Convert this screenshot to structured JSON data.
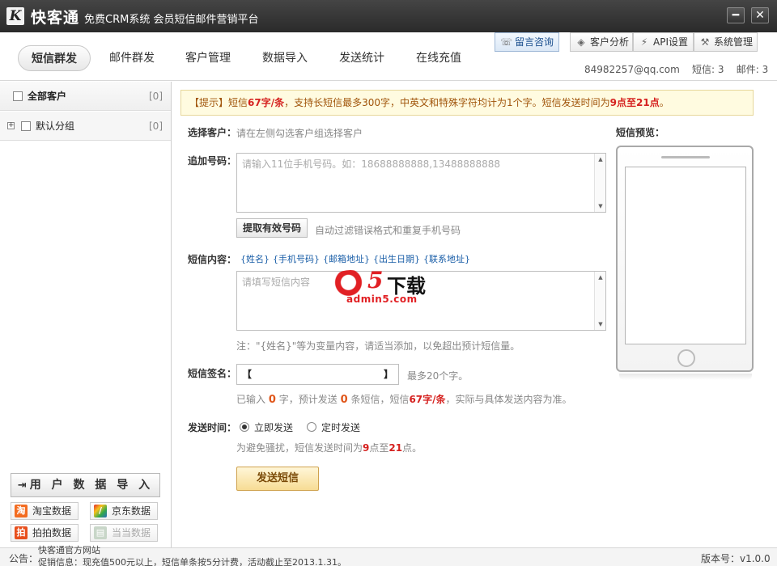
{
  "window": {
    "logo_letter": "K",
    "app_name": "快客通",
    "subtitle": "免费CRM系统 会员短信邮件营销平台",
    "minimize": "━",
    "close": "✕"
  },
  "nav": {
    "tabs": [
      {
        "label": "短信群发",
        "active": true
      },
      {
        "label": "邮件群发"
      },
      {
        "label": "客户管理"
      },
      {
        "label": "数据导入"
      },
      {
        "label": "发送统计"
      },
      {
        "label": "在线充值"
      }
    ],
    "top_buttons": {
      "message": "留言咨询",
      "analysis": "客户分析",
      "api": "API设置",
      "system": "系统管理"
    },
    "user": {
      "email": "84982257@qq.com",
      "sms_label": "短信: 3",
      "mail_label": "邮件: 3"
    }
  },
  "sidebar": {
    "all_customers": {
      "label": "全部客户",
      "count": "[0]"
    },
    "default_group": {
      "label": "默认分组",
      "count": "[0]"
    },
    "import_button": "用 户 数 据 导 入",
    "sources": [
      {
        "label": "淘宝数据",
        "icon": "淘"
      },
      {
        "label": "京东数据",
        "icon": "/"
      },
      {
        "label": "拍拍数据",
        "icon": "拍"
      },
      {
        "label": "当当数据",
        "icon": "▤",
        "disabled": true
      }
    ]
  },
  "tip": {
    "prefix": "【提示】短信",
    "rate": "67字/条",
    "middle": "，支持长短信最多300字，中英文和特殊字符均计为1个字。短信发送时间为",
    "hours": "9点至21点",
    "end": "。"
  },
  "form": {
    "select_customer_label": "选择客户：",
    "select_customer_hint": "请在左侧勾选客户组选择客户",
    "add_number_label": "追加号码：",
    "add_number_placeholder": "请输入11位手机号码。如：18688888888,13488888888",
    "extract_button": "提取有效号码",
    "extract_hint": "自动过滤错误格式和重复手机号码",
    "content_label": "短信内容：",
    "variables": [
      "{姓名}",
      "{手机号码}",
      "{邮箱地址}",
      "{出生日期}",
      "{联系地址}"
    ],
    "content_placeholder": "请填写短信内容",
    "content_note": "注：\"{姓名}\"等为变量内容，请适当添加，以免超出预计短信量。",
    "signature_label": "短信签名：",
    "signature_open": "【",
    "signature_close": "】",
    "signature_hint": "最多20个字。",
    "count_text_1": "已输入",
    "count_chars": "0",
    "count_text_2": "字，预计发送",
    "count_sms": "0",
    "count_text_3": "条短信，短信",
    "count_rate": "67字/条",
    "count_text_4": "，实际与具体发送内容为准。",
    "send_time_label": "发送时间：",
    "send_now": "立即发送",
    "send_scheduled": "定时发送",
    "time_note_1": "为避免骚扰，短信发送时间为",
    "time_note_start": "9",
    "time_note_2": "点至",
    "time_note_end": "21",
    "time_note_3": "点。",
    "send_button": "发送短信"
  },
  "preview": {
    "label": "短信预览："
  },
  "watermark": {
    "five": "5",
    "download": "下载",
    "site": "admin5.com"
  },
  "footer": {
    "notice_label": "公告：",
    "notice_line1": "快客通官方网站",
    "notice_line2": "促销信息：现充值500元以上，短信单条按5分计费，活动截止至2013.1.31。",
    "version": "版本号：v1.0.0"
  }
}
